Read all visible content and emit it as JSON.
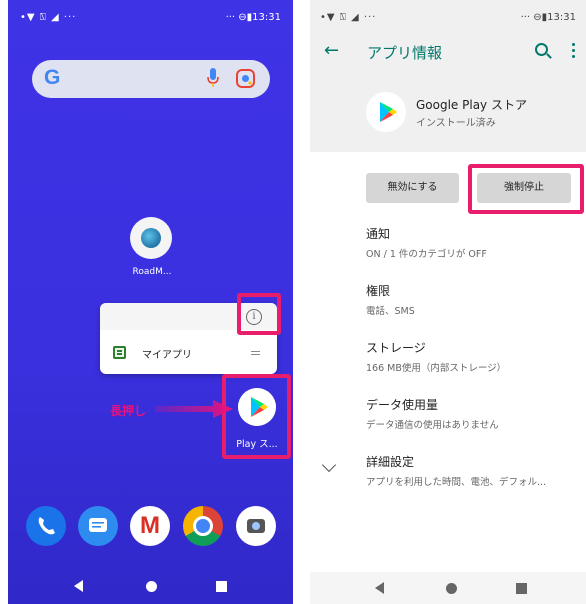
{
  "left_screen": {
    "status_bar": {
      "left_icons": "•▼ ⍂ ◢ ···",
      "right": "··· ⊖▮13:31"
    },
    "search_widget": {
      "logo": "G",
      "mic_icon": "mic-icon",
      "lens_icon": "lens-icon"
    },
    "apps": [
      {
        "name": "RoadM...",
        "icon": "roadmap-app-icon"
      }
    ],
    "shortcut_popup": {
      "info_icon": "info-icon",
      "info_glyph": "i",
      "item_label": "マイアプリ"
    },
    "play_store": {
      "label": "Play ス...",
      "icon": "google-play-icon"
    },
    "annotation": {
      "text": "長押し",
      "color": "#e8127c"
    },
    "dock": [
      "phone-icon",
      "messages-icon",
      "gmail-icon",
      "chrome-icon",
      "camera-icon"
    ],
    "gmail_glyph": "M",
    "highlight_color": "#e81e6c"
  },
  "right_screen": {
    "status_bar": {
      "left_icons": "•▼ ⍂ ◢ ···",
      "right": "··· ⊖▮13:31"
    },
    "header": {
      "back": "←",
      "title": "アプリ情報",
      "accent": "#00796b"
    },
    "app": {
      "name": "Google Play ストア",
      "status": "インストール済み"
    },
    "buttons": {
      "disable": "無効にする",
      "force_stop": "強制停止"
    },
    "items": [
      {
        "title": "通知",
        "sub": "ON / 1 件のカテゴリが OFF"
      },
      {
        "title": "権限",
        "sub": "電話、SMS"
      },
      {
        "title": "ストレージ",
        "sub": "166 MB使用（内部ストレージ）"
      },
      {
        "title": "データ使用量",
        "sub": "データ通信の使用はありません"
      },
      {
        "title": "詳細設定",
        "sub": "アプリを利用した時間、電池、デフォル..."
      }
    ]
  }
}
